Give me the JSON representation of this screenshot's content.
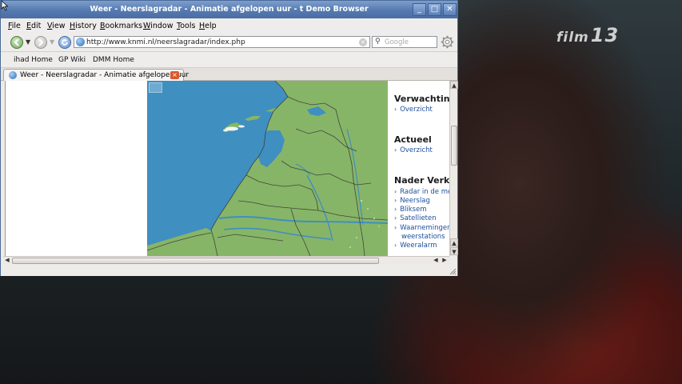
{
  "window": {
    "title": "Weer - Neerslagradar - Animatie afgelopen uur - t Demo Browser",
    "minimize_glyph": "_",
    "maximize_glyph": "□",
    "close_glyph": "✕"
  },
  "menubar": {
    "items": [
      {
        "acc": "F",
        "rest": "ile"
      },
      {
        "acc": "E",
        "rest": "dit"
      },
      {
        "acc": "V",
        "rest": "iew"
      },
      {
        "acc": "H",
        "rest": "istory"
      },
      {
        "acc": "B",
        "rest": "ookmarks"
      },
      {
        "acc": "W",
        "rest": "indow"
      },
      {
        "acc": "T",
        "rest": "ools"
      },
      {
        "acc": "H",
        "rest": "elp"
      }
    ]
  },
  "navbar": {
    "url": "http://www.knmi.nl/neerslagradar/index.php",
    "search_placeholder": "Google",
    "search_glyph": "⚲",
    "clear_glyph": "×",
    "dropdown_glyph": "▼"
  },
  "bookmarks": {
    "items": [
      "ihad Home",
      "GP Wiki",
      "DMM Home"
    ]
  },
  "tab": {
    "label": "Weer - Neerslagradar - Animatie afgelopen uur",
    "close_glyph": "×"
  },
  "sidebar": {
    "section1": {
      "heading": "Verwachting",
      "links": [
        "Overzicht"
      ]
    },
    "section2": {
      "heading": "Actueel",
      "links": [
        "Overzicht"
      ]
    },
    "section3": {
      "heading": "Nader Verklaard",
      "links": [
        "Radar in de meteorologie",
        "Neerslag",
        "Bliksem",
        "Satellieten",
        "Waarnemingen,",
        "Weeralarm"
      ],
      "wrapped": "weerstations"
    },
    "chevron": "›"
  },
  "scrollbars": {
    "up": "▲",
    "down": "▼",
    "left": "◀",
    "right": "▶"
  },
  "tv_overlay": {
    "logo_text": "film",
    "logo_number": "13"
  },
  "colors": {
    "sea": "#3f8fc0",
    "land": "#87b567",
    "title_bar": "#5579b0",
    "link": "#1d4f9c"
  }
}
